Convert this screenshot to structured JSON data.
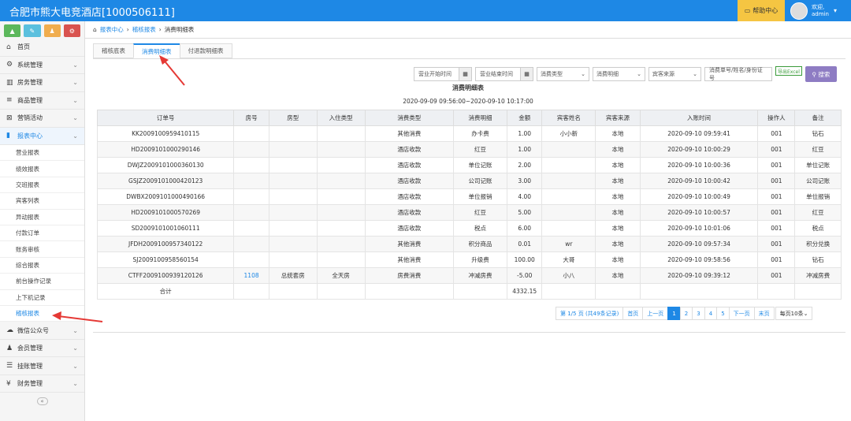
{
  "header": {
    "title": "合肥市熊大电竞酒店[1000506111]",
    "help_label": "帮助中心",
    "welcome": "欢迎,",
    "username": "admin"
  },
  "quick_buttons": [
    {
      "icon": "chart-icon",
      "color": "#5cb85c"
    },
    {
      "icon": "pencil-icon",
      "color": "#5bc0de"
    },
    {
      "icon": "users-icon",
      "color": "#f0ad4e"
    },
    {
      "icon": "settings-icon",
      "color": "#d9534f"
    }
  ],
  "sidebar": {
    "items": [
      {
        "label": "首页",
        "icon": "home-icon"
      },
      {
        "label": "系统管理",
        "icon": "gear-icon"
      },
      {
        "label": "房务管理",
        "icon": "building-icon"
      },
      {
        "label": "商品管理",
        "icon": "database-icon"
      },
      {
        "label": "营销活动",
        "icon": "gift-icon"
      },
      {
        "label": "报表中心",
        "icon": "bar-chart-icon"
      }
    ],
    "subitems": [
      "营业报表",
      "绩效报表",
      "交班报表",
      "宾客列表",
      "异动报表",
      "付款订单",
      "账务审核",
      "综合报表",
      "前台操作记录",
      "上下机记录",
      "稽核报表"
    ],
    "items_after": [
      {
        "label": "微信公众号",
        "icon": "cloud-icon"
      },
      {
        "label": "会员管理",
        "icon": "users-icon"
      },
      {
        "label": "挂账管理",
        "icon": "list-icon"
      },
      {
        "label": "财务管理",
        "icon": "cutlery-icon"
      }
    ],
    "collapse_label": "«"
  },
  "breadcrumb": {
    "root": "报表中心",
    "mid": "稽核报表",
    "current": "消费明细表",
    "sep": "›"
  },
  "tabs": [
    "稽核底表",
    "消费明细表",
    "付退款明细表"
  ],
  "filters": {
    "start_placeholder": "营业开始时间",
    "end_placeholder": "营业结束时间",
    "type_select": "消费类型",
    "detail_select": "消费明细",
    "source_select": "宾客来源",
    "keyword_placeholder": "消费单号/姓名/身份证号",
    "excel_label": "导出Excel",
    "search_label": "搜索"
  },
  "report": {
    "title": "消费明细表",
    "range": "2020-09-09 09:56:00~2020-09-10 10:17:00"
  },
  "table": {
    "headers": [
      "订单号",
      "房号",
      "房型",
      "入住类型",
      "消费类型",
      "消费明细",
      "金额",
      "宾客姓名",
      "宾客来源",
      "入账时间",
      "操作人",
      "备注"
    ],
    "rows": [
      [
        "KK2009100959410115",
        "",
        "",
        "",
        "其他消费",
        "办卡费",
        "1.00",
        "小小新",
        "本地",
        "2020-09-10 09:59:41",
        "001",
        "钻石"
      ],
      [
        "HD2009101000290146",
        "",
        "",
        "",
        "酒店收款",
        "红豆",
        "1.00",
        "",
        "本地",
        "2020-09-10 10:00:29",
        "001",
        "红豆"
      ],
      [
        "DWJZ2009101000360130",
        "",
        "",
        "",
        "酒店收款",
        "单位记账",
        "2.00",
        "",
        "本地",
        "2020-09-10 10:00:36",
        "001",
        "单位记账"
      ],
      [
        "GSJZ2009101000420123",
        "",
        "",
        "",
        "酒店收款",
        "公司记账",
        "3.00",
        "",
        "本地",
        "2020-09-10 10:00:42",
        "001",
        "公司记账"
      ],
      [
        "DWBX2009101000490166",
        "",
        "",
        "",
        "酒店收款",
        "单位报销",
        "4.00",
        "",
        "本地",
        "2020-09-10 10:00:49",
        "001",
        "单位报销"
      ],
      [
        "HD2009101000570269",
        "",
        "",
        "",
        "酒店收款",
        "红豆",
        "5.00",
        "",
        "本地",
        "2020-09-10 10:00:57",
        "001",
        "红豆"
      ],
      [
        "SD2009101001060111",
        "",
        "",
        "",
        "酒店收款",
        "税点",
        "6.00",
        "",
        "本地",
        "2020-09-10 10:01:06",
        "001",
        "税点"
      ],
      [
        "JFDH2009100957340122",
        "",
        "",
        "",
        "其他消费",
        "积分商品",
        "0.01",
        "wr",
        "本地",
        "2020-09-10 09:57:34",
        "001",
        "积分兑换"
      ],
      [
        "SJ2009100958560154",
        "",
        "",
        "",
        "其他消费",
        "升级费",
        "100.00",
        "大哥",
        "本地",
        "2020-09-10 09:58:56",
        "001",
        "钻石"
      ],
      [
        "CTFF2009100939120126",
        "1108",
        "总统套房",
        "全天房",
        "房费消费",
        "冲减房费",
        "-5.00",
        "小八",
        "本地",
        "2020-09-10 09:39:12",
        "001",
        "冲减房费"
      ]
    ],
    "total_label": "合计",
    "total_value": "4332.15"
  },
  "pager": {
    "info": "第 1/5 页 (共49条记录)",
    "first": "首页",
    "prev": "上一页",
    "pages": [
      "1",
      "2",
      "3",
      "4",
      "5"
    ],
    "next": "下一页",
    "last": "末页",
    "size": "每页10条"
  }
}
